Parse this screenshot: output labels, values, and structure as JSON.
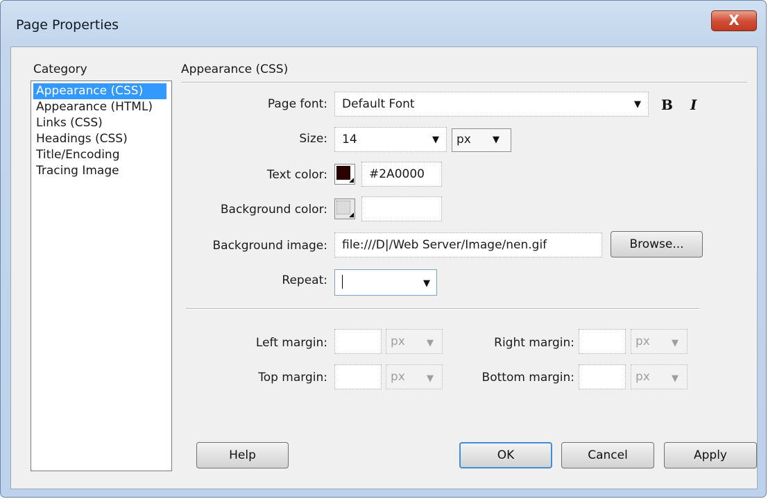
{
  "window": {
    "title": "Page Properties",
    "close_label": "X"
  },
  "category": {
    "heading": "Category",
    "items": [
      "Appearance (CSS)",
      "Appearance (HTML)",
      "Links (CSS)",
      "Headings (CSS)",
      "Title/Encoding",
      "Tracing Image"
    ],
    "selected_index": 0
  },
  "section": {
    "heading": "Appearance (CSS)"
  },
  "form": {
    "page_font_label": "Page font:",
    "page_font_value": "Default Font",
    "bold_label": "B",
    "italic_label": "I",
    "size_label": "Size:",
    "size_value": "14",
    "size_unit": "px",
    "text_color_label": "Text color:",
    "text_color_value": "#2A0000",
    "text_color_hex": "#2A0000",
    "bg_color_label": "Background color:",
    "bg_color_value": "",
    "bg_image_label": "Background image:",
    "bg_image_value": "file:///D|/Web Server/Image/nen.gif",
    "browse_label": "Browse...",
    "repeat_label": "Repeat:",
    "repeat_value": ""
  },
  "margins": {
    "left_label": "Left margin:",
    "right_label": "Right margin:",
    "top_label": "Top margin:",
    "bottom_label": "Bottom margin:",
    "unit": "px"
  },
  "buttons": {
    "help": "Help",
    "ok": "OK",
    "cancel": "Cancel",
    "apply": "Apply"
  }
}
